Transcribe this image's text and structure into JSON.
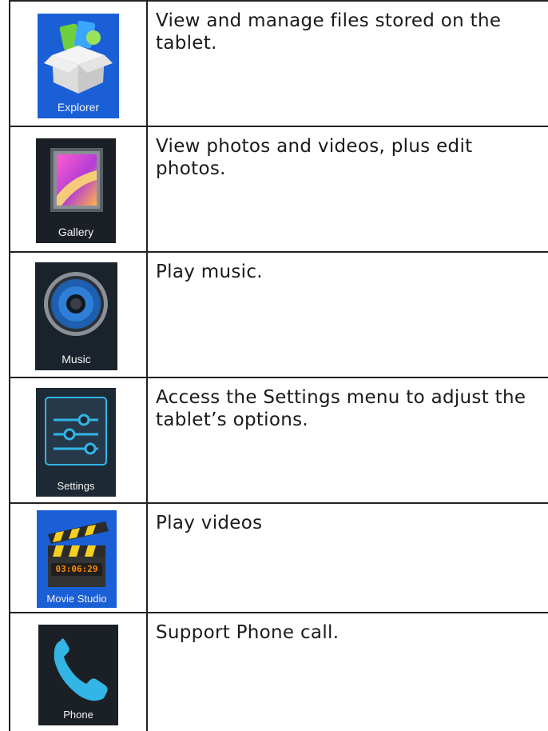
{
  "rows": [
    {
      "caption": "Explorer",
      "description": "View and manage files stored on the tablet.",
      "icon": "explorer-icon"
    },
    {
      "caption": "Gallery",
      "description": "View photos and videos, plus edit photos.",
      "icon": "gallery-icon"
    },
    {
      "caption": "Music",
      "description": "Play music.",
      "icon": "music-icon"
    },
    {
      "caption": "Settings",
      "description": "Access the Settings menu to adjust the tablet’s options.",
      "icon": "settings-icon"
    },
    {
      "caption": "Movie Studio",
      "description": "Play videos",
      "icon": "movie-studio-icon",
      "counter": "03:06:29"
    },
    {
      "caption": "Phone",
      "description": "Support Phone call.",
      "icon": "phone-icon"
    }
  ],
  "colors": {
    "border": "#222222",
    "blue_tile": "#1a5fd6",
    "dark_tile": "#1d2a35",
    "accent_blue": "#33b5e5",
    "movie_orange": "#ff8a00"
  }
}
